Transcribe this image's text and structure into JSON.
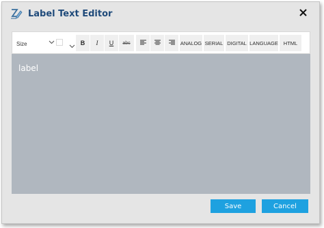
{
  "dialog": {
    "title": "Label Text Editor",
    "close_icon": "close-icon",
    "title_icon": "text-edit-icon"
  },
  "toolbar": {
    "size_value": "Size",
    "bold": "B",
    "italic": "I",
    "underline": "U",
    "strikethrough": "abc",
    "align_left_icon": "align-left-icon",
    "align_center_icon": "align-center-icon",
    "align_right_icon": "align-right-icon",
    "analog": "ANALOG",
    "serial": "SERIAL",
    "digital": "DIGITAL",
    "language": "LANGUAGE",
    "html": "HTML"
  },
  "editor": {
    "content": "label"
  },
  "footer": {
    "save_label": "Save",
    "cancel_label": "Cancel"
  },
  "colors": {
    "accent": "#1ea1e0",
    "title": "#1f4a7a",
    "editor_bg": "#b0b7bf",
    "dialog_bg": "#e5e5e5"
  }
}
